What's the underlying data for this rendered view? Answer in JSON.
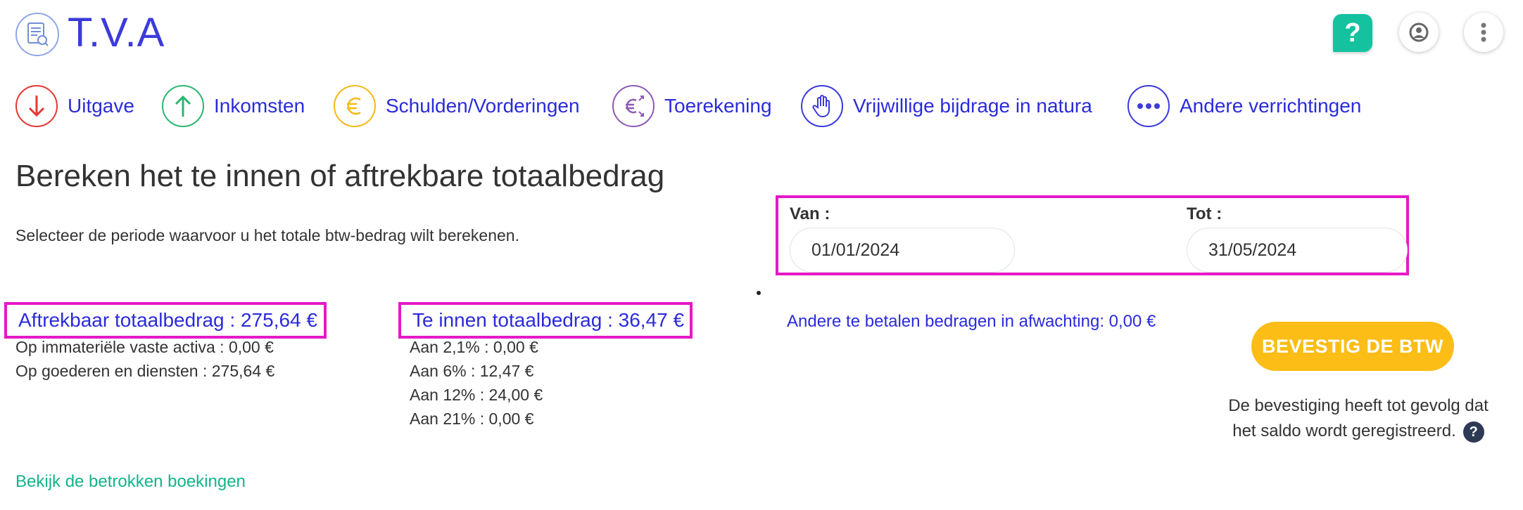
{
  "header": {
    "title": "T.V.A",
    "help_label": "?"
  },
  "nav": {
    "items": [
      {
        "label": "Uitgave",
        "icon": "arrow-down-icon",
        "color": "#e53935"
      },
      {
        "label": "Inkomsten",
        "icon": "arrow-up-icon",
        "color": "#2bb673"
      },
      {
        "label": "Schulden/Vorderingen",
        "icon": "euro-icon",
        "color": "#f5b915"
      },
      {
        "label": "Toerekening",
        "icon": "euro-transfer-icon",
        "color": "#8e5bb5"
      },
      {
        "label": "Vrijwillige bijdrage in natura",
        "icon": "hand-icon",
        "color": "#3b3bdb"
      },
      {
        "label": "Andere verrichtingen",
        "icon": "dots-icon",
        "color": "#3b3bdb"
      }
    ]
  },
  "main": {
    "title": "Bereken het te innen of aftrekbare totaalbedrag",
    "subtitle": "Selecteer de periode waarvoor u het totale btw-bedrag wilt berekenen."
  },
  "period": {
    "from_label": "Van :",
    "from_value": "01/01/2024",
    "to_label": "Tot :",
    "to_value": "31/05/2024"
  },
  "deductible": {
    "total": "Aftrekbaar totaalbedrag : 275,64 €",
    "lines": [
      "Op immateriële vaste activa : 0,00 €",
      "Op goederen en diensten : 275,64 €"
    ]
  },
  "collectible": {
    "total": "Te innen totaalbedrag : 36,47 €",
    "lines": [
      "Aan 2,1% : 0,00 €",
      "Aan 6% : 12,47 €",
      "Aan 12% : 24,00 €",
      "Aan 21% : 0,00 €"
    ]
  },
  "pending": {
    "text": "Andere te betalen bedragen in afwachting: 0,00 €"
  },
  "confirm": {
    "button_label": "BEVESTIG DE BTW",
    "note_line1": "De bevestiging heeft tot gevolg dat",
    "note_line2": "het saldo wordt geregistreerd.",
    "help_label": "?"
  },
  "bookings": {
    "link_text": "Bekijk de betrokken boekingen"
  },
  "colors": {
    "brand_blue": "#3b3bdb",
    "highlight": "#e619c7",
    "confirm_yellow": "#fbbd16",
    "help_green": "#14c2a0",
    "link_green": "#14b48a"
  }
}
